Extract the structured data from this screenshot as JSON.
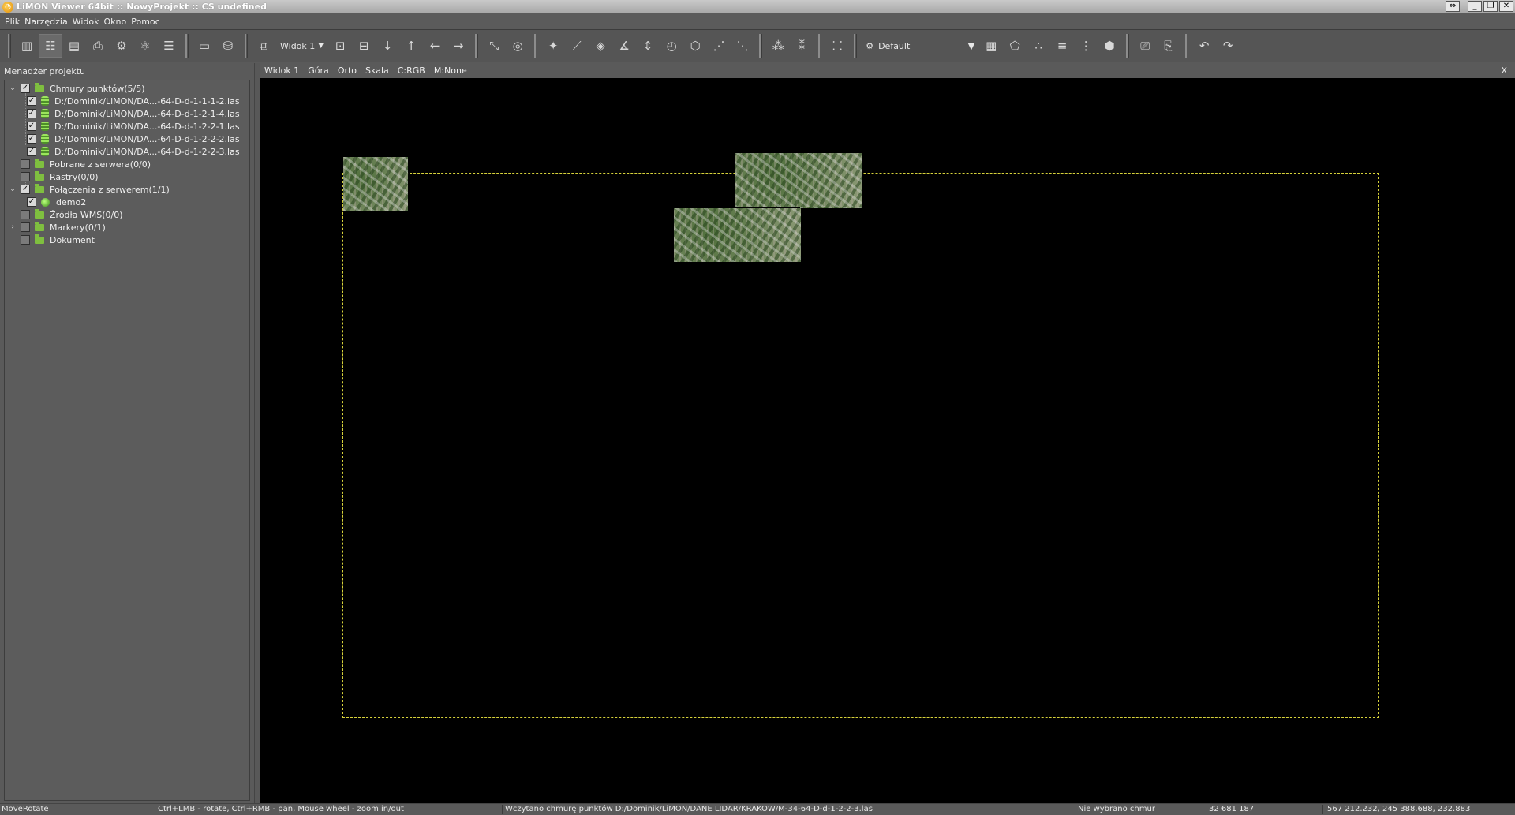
{
  "window": {
    "title": "LiMON Viewer 64bit :: NowyProjekt :: CS undefined",
    "controls": [
      "⇔",
      "_",
      "❐",
      "✕"
    ]
  },
  "menu": [
    "Plik",
    "Narzędzia",
    "Widok",
    "Okno",
    "Pomoc"
  ],
  "toolbar": {
    "view_select": "Widok 1",
    "style_combo": "Default",
    "icons": [
      "panel-layout-icon",
      "project-tree-icon",
      "properties-icon",
      "document-settings-icon",
      "layers-settings-icon",
      "render-settings-icon",
      "list-icon",
      "ruler-icon",
      "profile-icon",
      "view-3d-icon",
      "view-top-icon",
      "view-front-icon",
      "move-down-icon",
      "move-up-icon",
      "move-left-icon",
      "move-right-icon",
      "zoom-extent-icon",
      "orbit-icon",
      "add-point-icon",
      "measure-distance-icon",
      "measure-area-icon",
      "measure-angle-icon",
      "measure-height-icon",
      "measure-radius-icon",
      "measure-volume-icon",
      "measure-profile-icon",
      "measure-section-icon",
      "classify-icon",
      "filter-icon",
      "points-icon",
      "grid-icon",
      "shape-icon",
      "render-points-icon",
      "render-lines-icon",
      "render-mesh-icon",
      "render-solid-icon",
      "snapshot-icon",
      "export-icon",
      "undo-icon",
      "redo-icon"
    ]
  },
  "project_manager": {
    "title": "Menadżer projektu",
    "items": [
      {
        "label": "Chmury punktów(5/5)",
        "checked": true,
        "level": 0,
        "expander": "⌄",
        "icon": "folder"
      },
      {
        "label": "D:/Dominik/LiMON/DA...-64-D-d-1-1-1-2.las",
        "checked": true,
        "level": 1,
        "icon": "cloud"
      },
      {
        "label": "D:/Dominik/LiMON/DA...-64-D-d-1-2-1-4.las",
        "checked": true,
        "level": 1,
        "icon": "cloud"
      },
      {
        "label": "D:/Dominik/LiMON/DA...-64-D-d-1-2-2-1.las",
        "checked": true,
        "level": 1,
        "icon": "cloud"
      },
      {
        "label": "D:/Dominik/LiMON/DA...-64-D-d-1-2-2-2.las",
        "checked": true,
        "level": 1,
        "icon": "cloud"
      },
      {
        "label": "D:/Dominik/LiMON/DA...-64-D-d-1-2-2-3.las",
        "checked": true,
        "level": 1,
        "icon": "cloud"
      },
      {
        "label": "Pobrane z serwera(0/0)",
        "checked": false,
        "level": 0,
        "expander": "",
        "icon": "folder"
      },
      {
        "label": "Rastry(0/0)",
        "checked": false,
        "level": 0,
        "expander": "",
        "icon": "folder"
      },
      {
        "label": "Połączenia z serwerem(1/1)",
        "checked": true,
        "level": 0,
        "expander": "⌄",
        "icon": "folder"
      },
      {
        "label": "demo2",
        "checked": true,
        "level": 1,
        "icon": "server"
      },
      {
        "label": "Źródła WMS(0/0)",
        "checked": false,
        "level": 0,
        "expander": "",
        "icon": "folder"
      },
      {
        "label": "Markery(0/1)",
        "checked": false,
        "level": 0,
        "expander": "›",
        "icon": "folder"
      },
      {
        "label": "Dokument",
        "checked": false,
        "level": 0,
        "expander": "",
        "icon": "folder"
      }
    ]
  },
  "view_header": {
    "items": [
      "Widok 1",
      "Góra",
      "Orto",
      "Skala",
      "C:RGB",
      "M:None"
    ],
    "close": "X"
  },
  "status": {
    "mode": "MoveRotate",
    "hint": "Ctrl+LMB - rotate, Ctrl+RMB - pan, Mouse wheel - zoom in/out",
    "message": "Wczytano chmurę punktów D:/Dominik/LiMON/DANE LIDAR/KRAKOW/M-34-64-D-d-1-2-2-3.las",
    "selection": "Nie wybrano chmur",
    "points": "32 681 187",
    "coords": "567 212.232, 245 388.688, 232.883"
  },
  "colors": {
    "viewport_bg": "#000000",
    "bounding_box": "#d7d23a",
    "panel_bg": "#5a5a5a"
  }
}
